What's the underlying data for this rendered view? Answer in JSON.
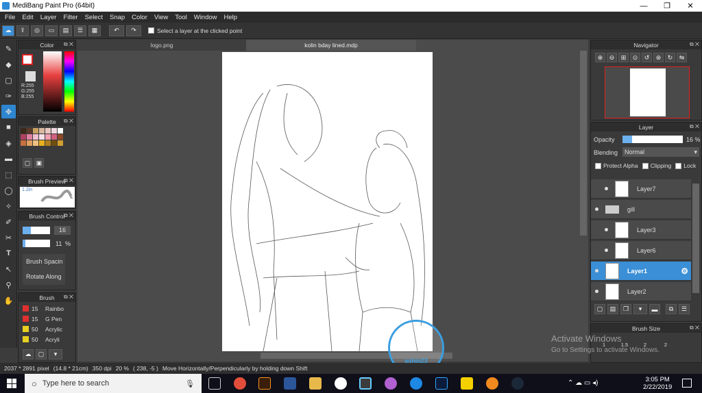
{
  "window": {
    "title": "MediBang Paint Pro (64bit)",
    "min": "—",
    "max": "❐",
    "close": "✕"
  },
  "menu": [
    "File",
    "Edit",
    "Layer",
    "Filter",
    "Select",
    "Snap",
    "Color",
    "View",
    "Tool",
    "Window",
    "Help"
  ],
  "toolbar": {
    "select_layer_label": "Select a layer at the clicked point"
  },
  "tabs": [
    {
      "label": "logo.png"
    },
    {
      "label": "kolin bday lined.mdp"
    }
  ],
  "color_panel": {
    "title": "Color",
    "r": "R:255",
    "g": "G:255",
    "b": "B:255"
  },
  "palette_panel": {
    "title": "Palette",
    "colors": [
      "#3a2a1a",
      "#5a3a2a",
      "#c8a060",
      "#d8b8a0",
      "#e8c8c0",
      "#f0d8e0",
      "#ffffff",
      "#b04060",
      "#e080a0",
      "#f0c0d0",
      "#f8e0e8",
      "#f0a0b0",
      "#d06080",
      "#8b4a2a",
      "#c87040",
      "#e0a060",
      "#f0c080",
      "#e8b020",
      "#b08020",
      "#705010",
      "#d0a030"
    ]
  },
  "brush_preview": {
    "title": "Brush Preview",
    "size": "1.2in"
  },
  "brush_control": {
    "title": "Brush Control",
    "size": "16",
    "opacity": "11",
    "opacity_unit": "%",
    "opt1": "Brush Spacin",
    "opt2": "Rotate Along"
  },
  "brush_panel": {
    "title": "Brush",
    "items": [
      {
        "size": "15",
        "name": "Rainbo",
        "color": "#e03030"
      },
      {
        "size": "15",
        "name": "G Pen",
        "color": "#e03030"
      },
      {
        "size": "50",
        "name": "Acrylic",
        "color": "#e8d020"
      },
      {
        "size": "50",
        "name": "Acryli",
        "color": "#e8d020"
      }
    ]
  },
  "navigator": {
    "title": "Navigator"
  },
  "layer_panel": {
    "title": "Layer",
    "opacity_label": "Opacity",
    "opacity_value": "16 %",
    "blending_label": "Blending",
    "blending_value": "Normal",
    "protect_alpha": "Protect Alpha",
    "clipping": "Clipping",
    "lock": "Lock",
    "layers": [
      {
        "name": "Layer7"
      },
      {
        "name": "gill"
      },
      {
        "name": "Layer3"
      },
      {
        "name": "Layer6"
      },
      {
        "name": "Layer1"
      },
      {
        "name": "Layer2"
      }
    ]
  },
  "brush_size_panel": {
    "title": "Brush Size",
    "sizes": [
      "1",
      "1.5",
      "2",
      "2"
    ]
  },
  "status": {
    "pixels": "2037 * 2891 pixel",
    "cm": "(14.8 * 21cm)",
    "dpi": "350 dpi",
    "zoom": "20 %",
    "coords": "( 238, -5 )",
    "hint": "Move Horizontally/Perpendicularly by holding down Shift"
  },
  "activate": {
    "line1": "Activate Windows",
    "line2": "Go to Settings to activate Windows."
  },
  "watermark": {
    "text": "ashin23"
  },
  "taskbar": {
    "search": "Type here to search",
    "time": "3:05 PM",
    "date": "2/22/2019"
  }
}
